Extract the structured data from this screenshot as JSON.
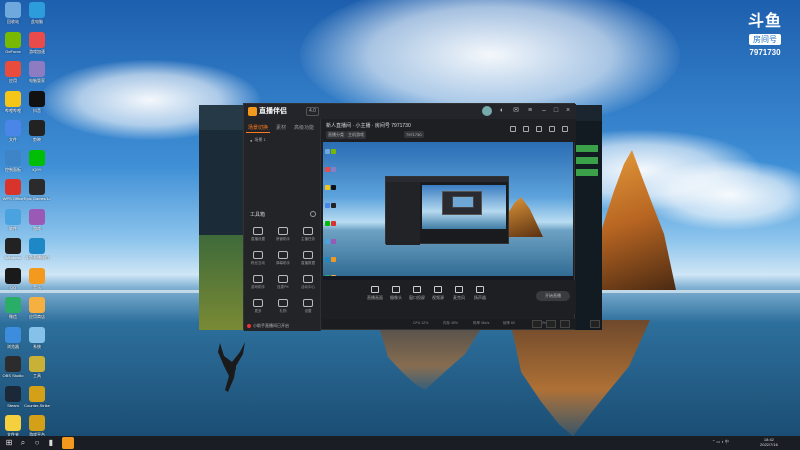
{
  "room_badge": {
    "logo": "斗鱼",
    "label": "房间号",
    "number": "7971730"
  },
  "desktop_icons": [
    {
      "name": "回收站",
      "color": "#6fa8dc"
    },
    {
      "name": "此电脑",
      "color": "#2d9cdb"
    },
    {
      "name": "GeForce",
      "color": "#76b900"
    },
    {
      "name": "游戏加速",
      "color": "#e94a4a"
    },
    {
      "name": "应用",
      "color": "#e84c3d"
    },
    {
      "name": "电脑管家",
      "color": "#8e7cc3"
    },
    {
      "name": "哔哩哔哩",
      "color": "#f5c518"
    },
    {
      "name": "抖音",
      "color": "#111111"
    },
    {
      "name": "文件",
      "color": "#4a86e8"
    },
    {
      "name": "剪映",
      "color": "#222222"
    },
    {
      "name": "控制面板",
      "color": "#3d85c6"
    },
    {
      "name": "iQIYI",
      "color": "#00be06"
    },
    {
      "name": "WPS Office",
      "color": "#d9342b"
    },
    {
      "name": "Epic Games Launcher",
      "color": "#2b2b2b"
    },
    {
      "name": "软件",
      "color": "#4aa3df"
    },
    {
      "name": "游戏",
      "color": "#9b59b6"
    },
    {
      "name": "Windows",
      "color": "#222222"
    },
    {
      "name": "斗鱼直播伴侣",
      "color": "#1e88c7"
    },
    {
      "name": "QQ",
      "color": "#1a1a1a"
    },
    {
      "name": "音乐",
      "color": "#f39a1e"
    },
    {
      "name": "微信",
      "color": "#2aae67"
    },
    {
      "name": "应用商店",
      "color": "#f5b041"
    },
    {
      "name": "浏览器",
      "color": "#3c8dde"
    },
    {
      "name": "系统",
      "color": "#85c1e9"
    },
    {
      "name": "OBS Studio",
      "color": "#2c2c2c"
    },
    {
      "name": "工具",
      "color": "#c9b037"
    },
    {
      "name": "Steam",
      "color": "#1b2838"
    },
    {
      "name": "Counter-Strike",
      "color": "#d4a017"
    },
    {
      "name": "文件夹",
      "color": "#f4d03f"
    },
    {
      "name": "游戏平台",
      "color": "#d4a017"
    }
  ],
  "main_window": {
    "app_name": "直播伴侣",
    "version": "4.0",
    "tabs": [
      "场景切换",
      "素材",
      "高级功能"
    ],
    "scene_item": "场景 1",
    "tools_section": "工具箱",
    "tools": [
      {
        "label": "直播设置"
      },
      {
        "label": "房管助手"
      },
      {
        "label": "主播任务"
      },
      {
        "label": "粉丝互动"
      },
      {
        "label": "弹幕助手"
      },
      {
        "label": "直播数据"
      },
      {
        "label": "游戏助手"
      },
      {
        "label": "连麦PK"
      },
      {
        "label": "活动中心"
      },
      {
        "label": "更多"
      },
      {
        "label": "礼物"
      },
      {
        "label": "设置"
      }
    ],
    "notice": "小助手直播间已开启",
    "live_title": "新人直播间 · 小主播 · 房间号 7971730",
    "live_tag_1": "直播分类",
    "live_tag_2": "主机游戏",
    "live_tag_3": "7971730",
    "controls": [
      {
        "label": "直播画面"
      },
      {
        "label": "摄像头"
      },
      {
        "label": "窗口投屏"
      },
      {
        "label": "视频源"
      },
      {
        "label": "麦克风"
      },
      {
        "label": "扬声器"
      }
    ],
    "start_button": "开始直播",
    "status": [
      "CPU 12%",
      "内存 45%",
      "码率 0kb/s",
      "帧率 60",
      "丢帧 0%"
    ]
  },
  "taskbar": {
    "time": "18:42",
    "date": "2022/7/16"
  }
}
